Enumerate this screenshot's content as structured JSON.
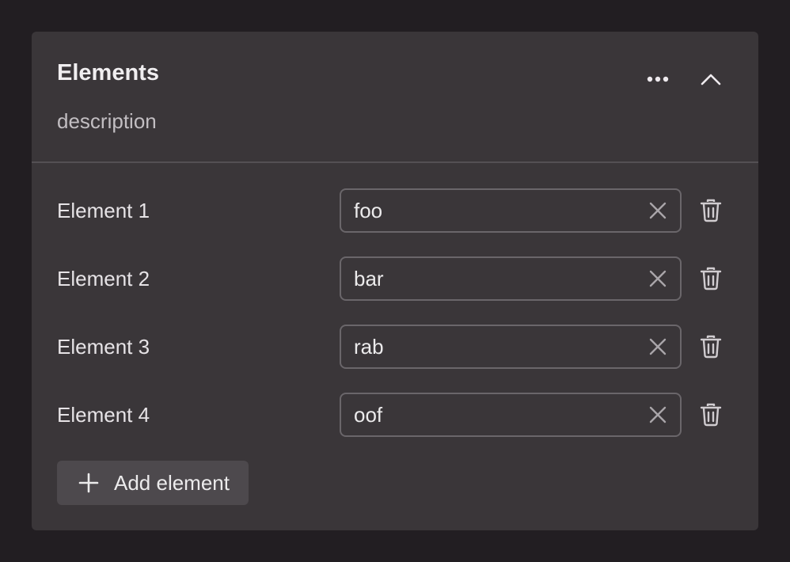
{
  "panel": {
    "title": "Elements",
    "description": "description",
    "more_icon": "more-horizontal-icon",
    "collapse_icon": "chevron-up-icon"
  },
  "elements": [
    {
      "label": "Element 1",
      "value": "foo"
    },
    {
      "label": "Element 2",
      "value": "bar"
    },
    {
      "label": "Element 3",
      "value": "rab"
    },
    {
      "label": "Element 4",
      "value": "oof"
    }
  ],
  "add_button": {
    "label": "Add element",
    "icon": "plus-icon"
  },
  "colors": {
    "background": "#221e22",
    "card": "#3a3639",
    "field_border": "#6a666a",
    "button_bg": "#4d494d",
    "text": "#ecebec"
  }
}
